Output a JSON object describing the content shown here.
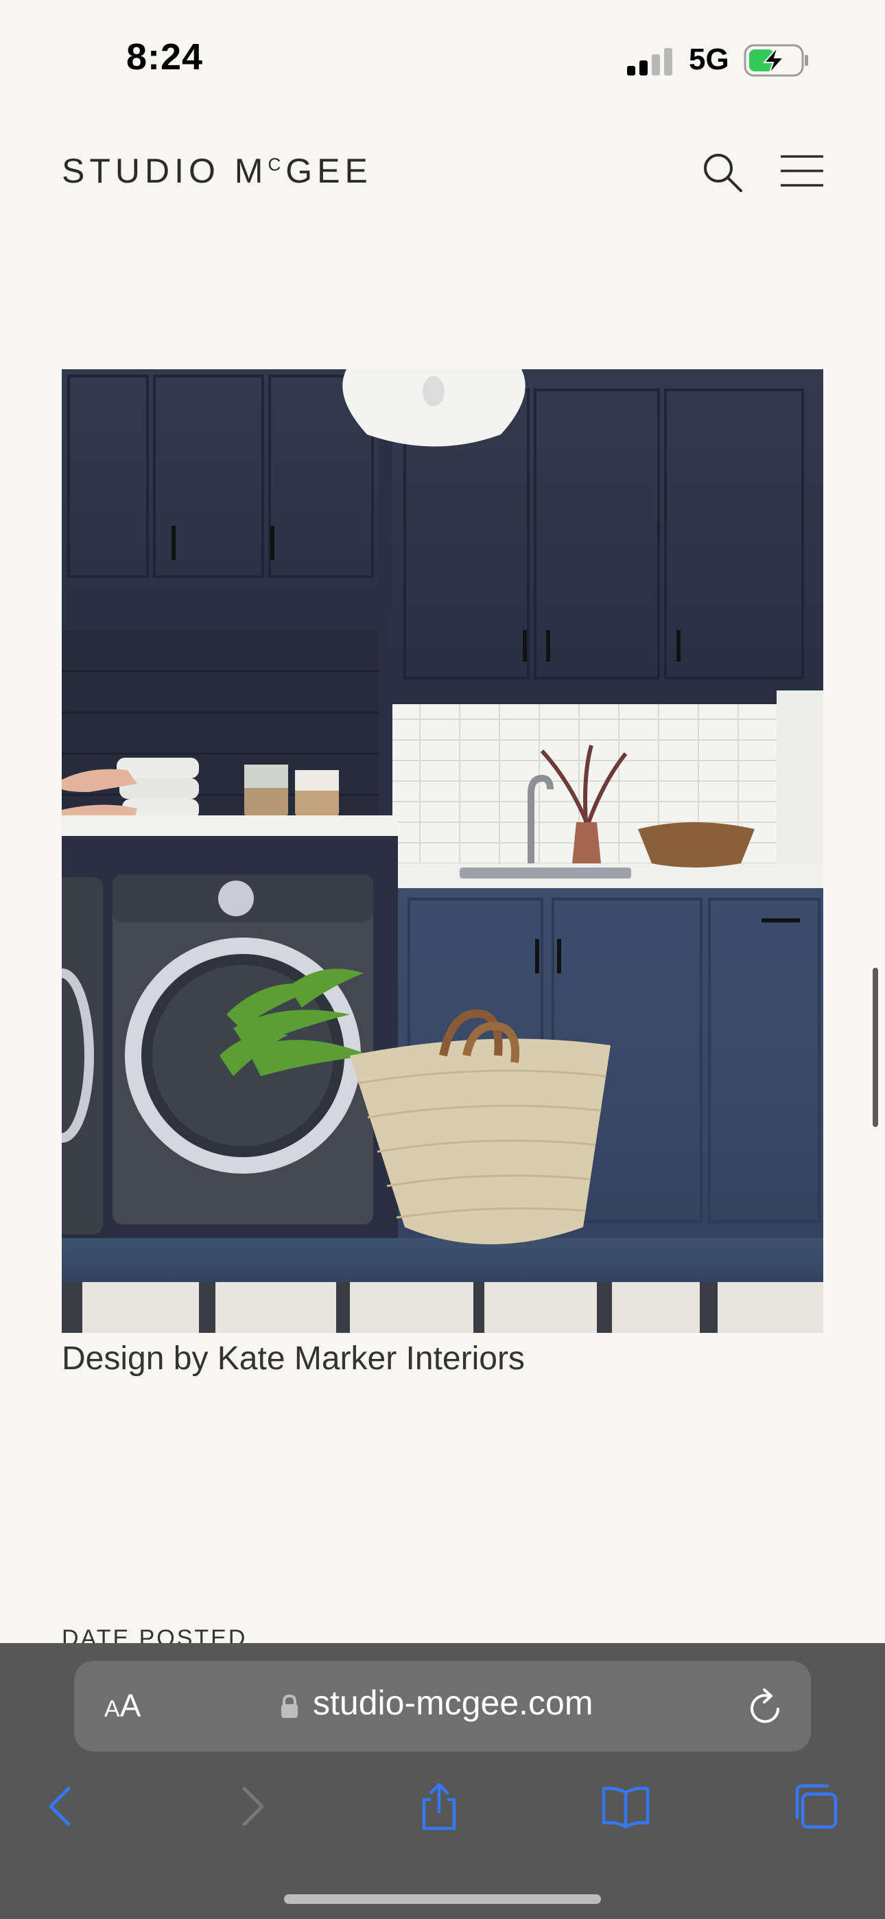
{
  "status": {
    "time": "8:24",
    "network": "5G"
  },
  "site": {
    "logo_main": "STUDIO M",
    "logo_sup": "C",
    "logo_end": "GEE"
  },
  "article": {
    "photo_alt": "Navy laundry room with washer and woven basket",
    "caption": "Design by Kate Marker Interiors",
    "next_section_label": "DATE POSTED"
  },
  "browser": {
    "text_size_small": "A",
    "text_size_large": "A",
    "url": "studio-mcgee.com"
  },
  "icons": {
    "search": "search-icon",
    "menu": "hamburger-menu-icon",
    "lock": "lock-icon",
    "reload": "reload-icon",
    "back": "chevron-left-icon",
    "forward": "chevron-right-icon",
    "share": "share-icon",
    "bookmarks": "book-icon",
    "tabs": "tabs-icon"
  },
  "colors": {
    "accent": "#3478f6",
    "navy": "#2e3446",
    "background": "#f7f6f3"
  }
}
